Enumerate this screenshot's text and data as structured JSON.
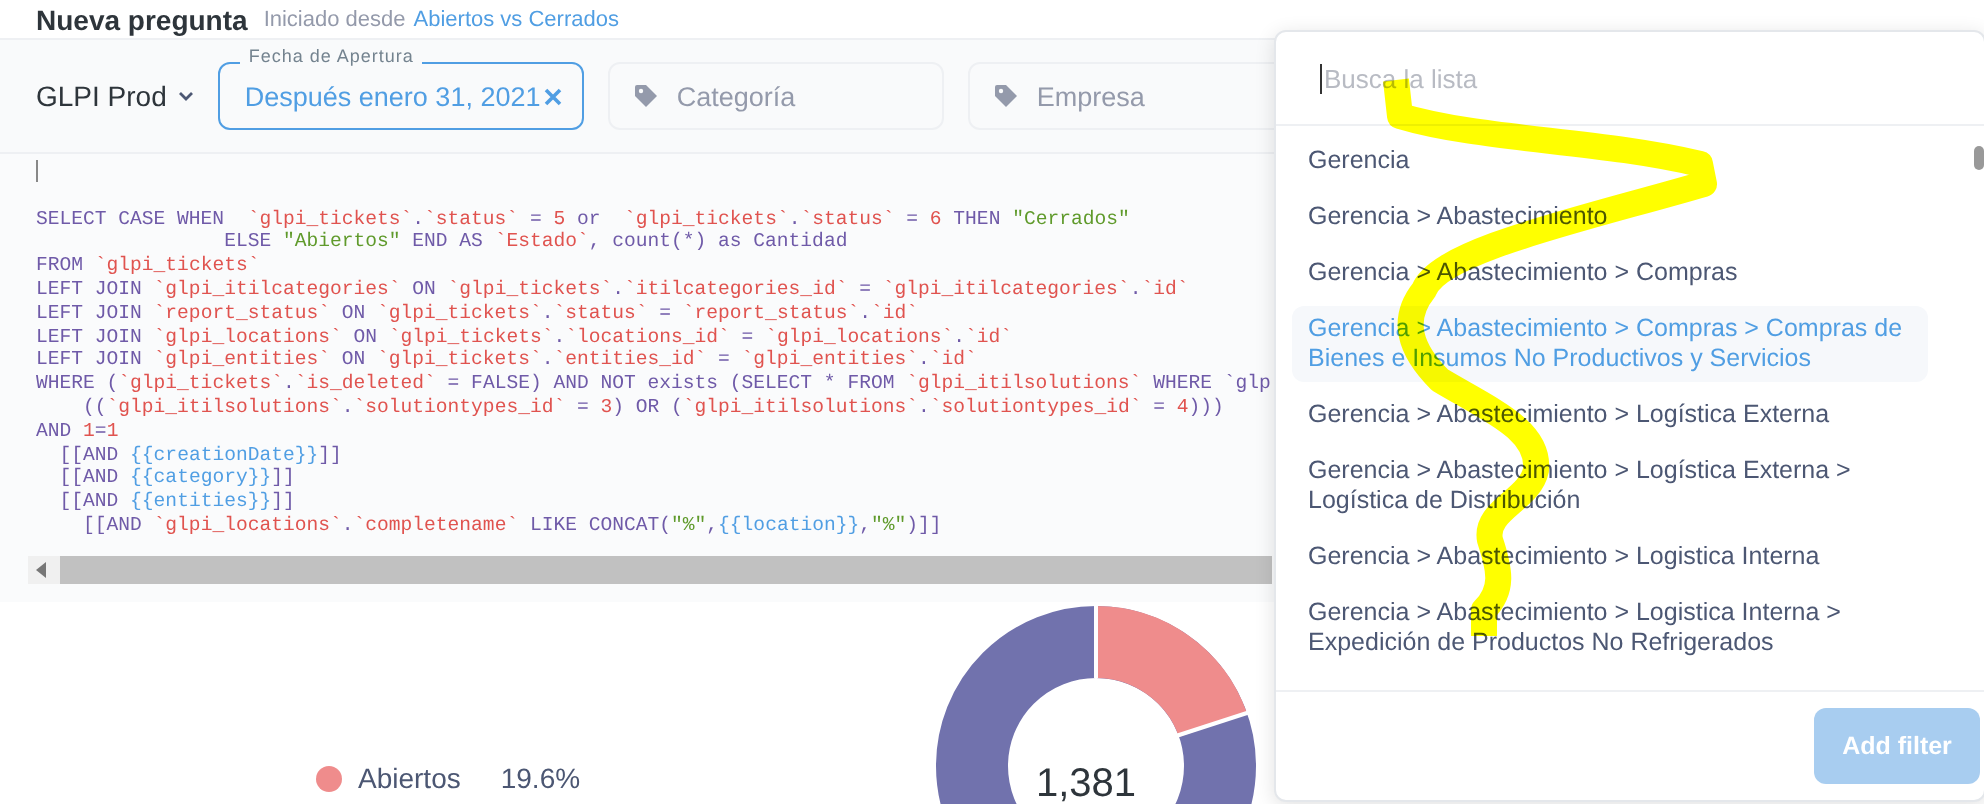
{
  "header": {
    "title": "Nueva pregunta",
    "source_prefix": "Iniciado desde",
    "source_link": "Abiertos vs Cerrados"
  },
  "filter_bar": {
    "database": "GLPI Prod",
    "filters": [
      {
        "kind": "date",
        "label": "Fecha de Apertura",
        "value": "Después enero 31, 2021"
      },
      {
        "kind": "tag",
        "placeholder": "Categoría"
      },
      {
        "kind": "tag",
        "placeholder": "Empresa"
      }
    ]
  },
  "editor": {
    "lines": [
      "SELECT CASE WHEN  `glpi_tickets`.`status` = 5 or  `glpi_tickets`.`status` = 6 THEN \"Cerrados\"",
      "                ELSE \"Abiertos\" END AS `Estado`, count(*) as Cantidad",
      "FROM `glpi_tickets`",
      "LEFT JOIN `glpi_itilcategories` ON `glpi_tickets`.`itilcategories_id` = `glpi_itilcategories`.`id`",
      "LEFT JOIN `report_status` ON `glpi_tickets`.`status` = `report_status`.`id`",
      "LEFT JOIN `glpi_locations` ON `glpi_tickets`.`locations_id` = `glpi_locations`.`id`",
      "LEFT JOIN `glpi_entities` ON `glpi_tickets`.`entities_id` = `glpi_entities`.`id`",
      "WHERE (`glpi_tickets`.`is_deleted` = FALSE) AND NOT exists (SELECT * FROM `glpi_itilsolutions` WHERE `glp",
      "    ((`glpi_itilsolutions`.`solutiontypes_id` = 3) OR (`glpi_itilsolutions`.`solutiontypes_id` = 4)))",
      "AND 1=1",
      "  [[AND {{creationDate}}]]",
      "  [[AND {{category}}]]",
      "  [[AND {{entities}}]]",
      "    [[AND `glpi_locations`.`completename` LIKE CONCAT(\"%\",{{location}},\"%\")]]"
    ]
  },
  "result": {
    "legend": [
      {
        "label": "Abiertos",
        "percent": "19.6%",
        "color": "#ef8c8c"
      }
    ],
    "total": "1,381"
  },
  "popover": {
    "search": {
      "placeholder": "Busca la lista"
    },
    "items": [
      {
        "label": "Gerencia",
        "selected": false
      },
      {
        "label": "Gerencia > Abastecimiento",
        "selected": false
      },
      {
        "label": "Gerencia > Abastecimiento > Compras",
        "selected": false
      },
      {
        "label": "Gerencia > Abastecimiento > Compras > Compras de Bienes e Insumos No Productivos y Servicios",
        "selected": true
      },
      {
        "label": "Gerencia > Abastecimiento > Logística Externa",
        "selected": false
      },
      {
        "label": "Gerencia > Abastecimiento > Logística Externa > Logística de Distribución",
        "selected": false
      },
      {
        "label": "Gerencia > Abastecimiento > Logistica Interna",
        "selected": false
      },
      {
        "label": "Gerencia > Abastecimiento > Logistica Interna > Expedición de Productos No Refrigerados",
        "selected": false
      }
    ],
    "button": {
      "label": "Add filter",
      "disabled": true
    }
  }
}
